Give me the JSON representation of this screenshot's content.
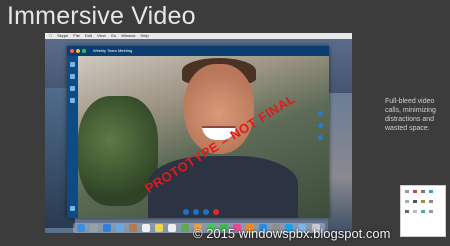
{
  "slide": {
    "title": "Immersive Video",
    "caption": "Full-bleed video calls, minimizing distractions and wasted space."
  },
  "mac": {
    "menubar": [
      "Skype",
      "File",
      "Edit",
      "View",
      "Go",
      "Window",
      "Help"
    ]
  },
  "app": {
    "meeting_title": "Weekly Team Meeting",
    "watermark": "PROTOTYPE – NOT FINAL",
    "accent_color": "#0a3e70",
    "end_call_color": "#d9272e"
  },
  "footer": {
    "copyright": "© 2015 windowspbx.blogspot.com"
  },
  "icons": {
    "sidebar": [
      "chat-icon",
      "contacts-icon",
      "calls-icon",
      "favorites-icon",
      "settings-icon"
    ],
    "call_controls": [
      "microphone-icon",
      "video-icon",
      "chat-icon",
      "end-call-icon"
    ],
    "rail": [
      "add-participant-icon",
      "share-icon",
      "more-icon"
    ],
    "dock": [
      "finder-icon",
      "launchpad-icon",
      "safari-icon",
      "mail-icon",
      "contacts-icon",
      "calendar-icon",
      "notes-icon",
      "reminders-icon",
      "maps-icon",
      "photos-icon",
      "messages-icon",
      "facetime-icon",
      "itunes-icon",
      "ibooks-icon",
      "appstore-icon",
      "preferences-icon",
      "skype-icon",
      "folder-icon",
      "trash-icon"
    ]
  }
}
